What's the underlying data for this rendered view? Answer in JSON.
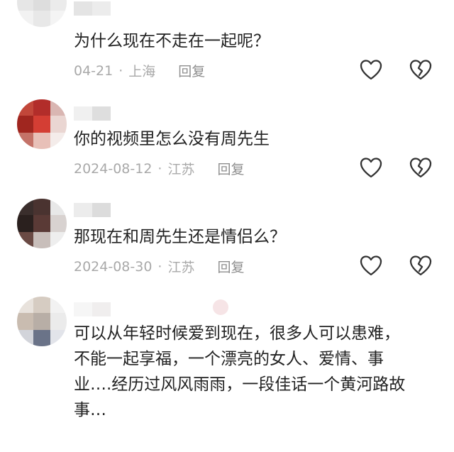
{
  "comments": [
    {
      "text": "为什么现在不走在一起呢？",
      "date": "04-21",
      "separator": "·",
      "location": "上海",
      "reply_label": "回复"
    },
    {
      "text": "你的视频里怎么没有周先生",
      "date": "2024-08-12",
      "separator": "·",
      "location": "江苏",
      "reply_label": "回复"
    },
    {
      "text": "那现在和周先生还是情侣么？",
      "date": "2024-08-30",
      "separator": "·",
      "location": "江苏",
      "reply_label": "回复"
    },
    {
      "text": "可以从年轻时候爱到现在，很多人可以患难，不能一起享福，一个漂亮的女人、爱情、事业….经历过风风雨雨，一段佳话一个黄河路故事…"
    }
  ],
  "icons": {
    "like": "heart-icon",
    "dislike": "broken-heart-icon"
  },
  "colors": {
    "text": "#222222",
    "meta": "#a9a9a9",
    "reply": "#8e8e8e",
    "icon_stroke": "#333333"
  }
}
